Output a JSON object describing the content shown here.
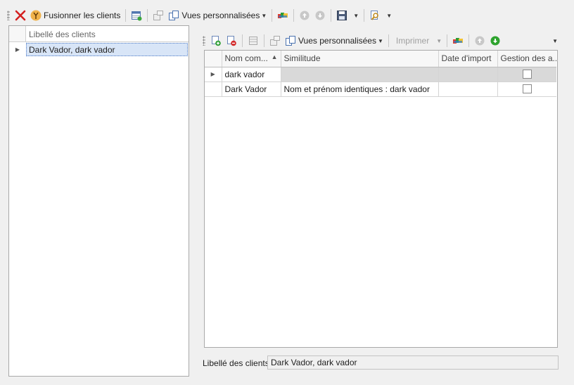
{
  "main_toolbar": {
    "merge_label": "Fusionner les clients",
    "views_label": "Vues personnalisées"
  },
  "left_grid": {
    "column_header": "Libellé des clients",
    "rows": [
      "Dark Vador, dark vador"
    ]
  },
  "detail_toolbar": {
    "views_label": "Vues personnalisées",
    "print_label": "Imprimer"
  },
  "detail_grid": {
    "columns": [
      "Nom com...",
      "Similitude",
      "Date d'import",
      "Gestion des a..."
    ],
    "rows": [
      {
        "name": "dark vador",
        "similarity": "",
        "import_date": "",
        "checked": false
      },
      {
        "name": "Dark Vador",
        "similarity": "Nom et prénom identiques : dark vador",
        "import_date": "",
        "checked": false
      }
    ]
  },
  "footer": {
    "label": "Libellé des clients:",
    "value": "Dark Vador, dark vador"
  }
}
